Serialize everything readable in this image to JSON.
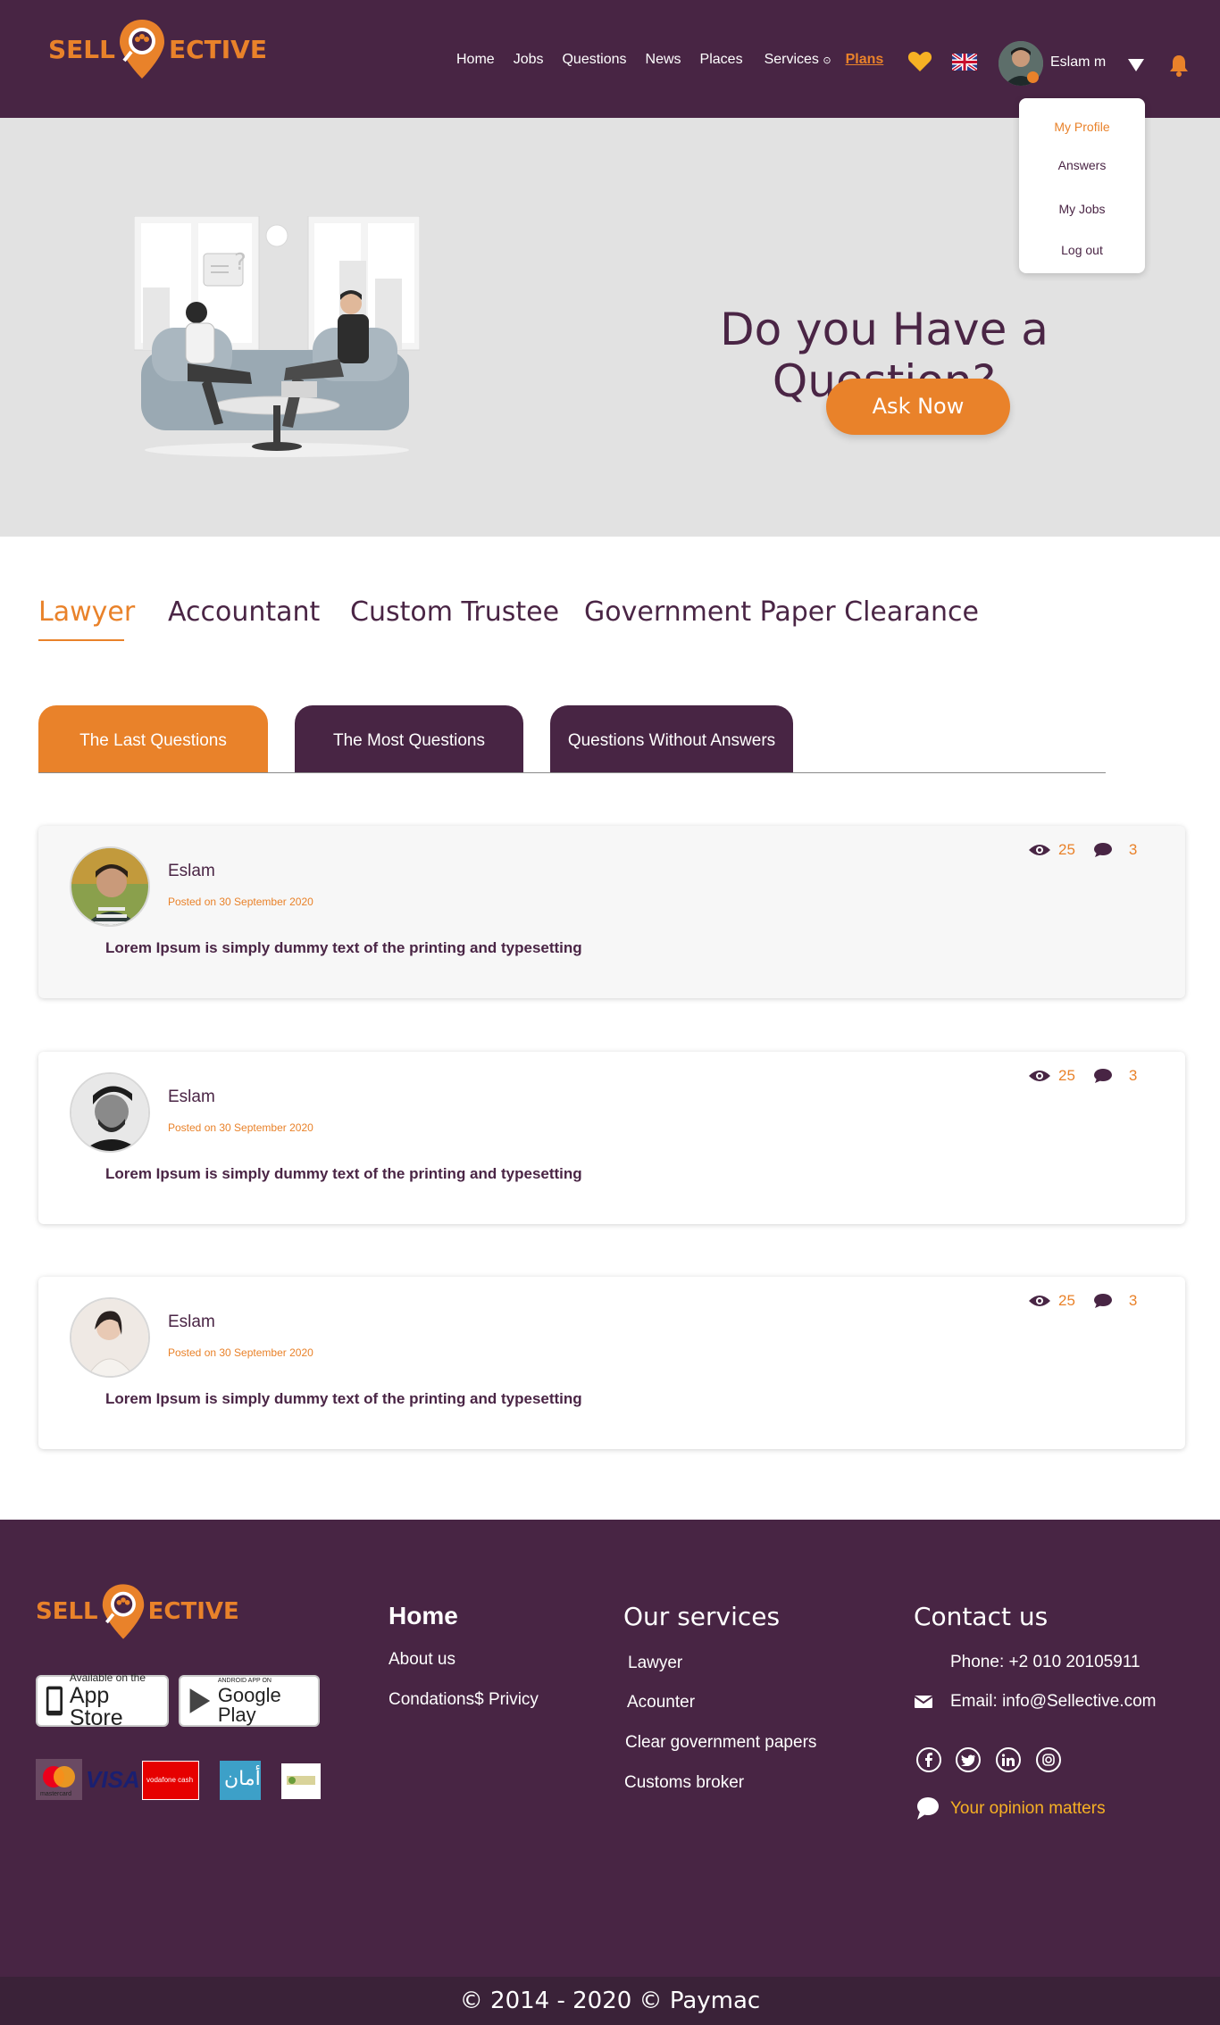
{
  "header": {
    "logo_left": "SELL",
    "logo_right": "ECTIVE",
    "nav": [
      "Home",
      "Jobs",
      "Questions",
      "News",
      "Places",
      "Services"
    ],
    "services_caret": "⊙",
    "plans": "Plans",
    "user_name": "Eslam m"
  },
  "dropdown": {
    "items": [
      "My Profile",
      "Answers",
      "My Jobs",
      "Log out"
    ]
  },
  "hero": {
    "title": "Do you Have a Question?",
    "button": "Ask Now"
  },
  "categories": [
    "Lawyer",
    "Accountant",
    "Custom Trustee",
    "Government Paper Clearance"
  ],
  "subtabs": [
    "The Last Questions",
    "The Most Questions",
    "Questions Without Answers"
  ],
  "questions": [
    {
      "name": "Eslam",
      "date": "Posted on 30 September 2020",
      "text": "Lorem Ipsum is simply dummy text of the printing and typesetting",
      "views": "25",
      "comments": "3"
    },
    {
      "name": "Eslam",
      "date": "Posted on 30 September 2020",
      "text": "Lorem Ipsum is simply dummy text of the printing and typesetting",
      "views": "25",
      "comments": "3"
    },
    {
      "name": "Eslam",
      "date": "Posted on 30 September 2020",
      "text": "Lorem Ipsum is simply dummy text of the printing and typesetting",
      "views": "25",
      "comments": "3"
    }
  ],
  "footer": {
    "logo_left": "SELL",
    "logo_right": "ECTIVE",
    "app_store": {
      "small": "Available on the",
      "big": "App Store"
    },
    "google_play": {
      "small": "ANDROID APP ON",
      "big": "Google Play"
    },
    "home_heading": "Home",
    "home_links": [
      "About us",
      "Condations$ Privicy"
    ],
    "services_heading": "Our services",
    "services_links": [
      "Lawyer",
      "Acounter",
      "Clear government papers",
      "Customs broker"
    ],
    "contact_heading": "Contact us",
    "phone": "Phone: +2 010 20105911",
    "email": "Email: info@Sellective.com",
    "opinion": "Your opinion matters",
    "copyright": "© 2014 - 2020 © Paymac",
    "payment_labels": {
      "mastercard": "mastercard",
      "visa": "VISA",
      "vodafone": "vodafone cash",
      "aman": "أمان"
    }
  },
  "colors": {
    "primary": "#482544",
    "accent": "#e9822a",
    "hero_bg": "#e2e2e2",
    "opinion": "#f7b124"
  }
}
